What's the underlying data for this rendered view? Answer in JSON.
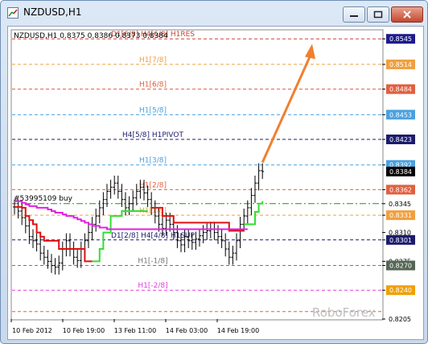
{
  "window": {
    "title": "NZDUSD,H1",
    "minimize_icon": "minimize-icon",
    "maximize_icon": "maximize-icon",
    "close_icon": "close-icon"
  },
  "chart_info": {
    "label": "NZDUSD,H1  0.8375 0.8386 0.8373 0.8384",
    "buy_label": "#53995109 buy",
    "watermark": "RoboForex"
  },
  "chart_data": {
    "type": "line",
    "title": "",
    "ylim": [
      0.8205,
      0.8555
    ],
    "y_ticks": [
      "0.8545",
      "0.8514",
      "0.8484",
      "0.8453",
      "0.8423",
      "0.8392",
      "0.8362",
      "0.8345",
      "0.8331",
      "0.8310",
      "0.8301",
      "0.8275",
      "0.8270",
      "0.8240",
      "0.8205"
    ],
    "x_ticks": [
      "10 Feb 2012",
      "10 Feb 19:00",
      "13 Feb 11:00",
      "14 Feb 03:00",
      "14 Feb 19:00"
    ],
    "current_price": "0.8384",
    "murrey_levels": [
      {
        "label": "D1[6/8] H4[6/8] H1RES",
        "value": 0.8545,
        "color": "#cc4433",
        "tag": "0.8545",
        "tag_color": "#1c1c8c"
      },
      {
        "label": "H1[7/8]",
        "value": 0.8514,
        "color": "#f0a040",
        "tag": "0.8514",
        "tag_color": "#f0a040"
      },
      {
        "label": "H1[6/8]",
        "value": 0.8484,
        "color": "#e06040",
        "tag": "0.8484",
        "tag_color": "#e06040"
      },
      {
        "label": "H1[5/8]",
        "value": 0.8453,
        "color": "#4aa0e0",
        "tag": "0.8453",
        "tag_color": "#4aa0e0"
      },
      {
        "label": "H4[5/8] H1PIVOT",
        "value": 0.8423,
        "color": "#1c1c6c",
        "tag": "0.8423",
        "tag_color": "#1c1c6c"
      },
      {
        "label": "H1[3/8]",
        "value": 0.8392,
        "color": "#4aa0e0",
        "tag": "0.8392",
        "tag_color": "#4aa0e0"
      },
      {
        "label": "H1[2/8]",
        "value": 0.8362,
        "color": "#e06040",
        "tag": "0.8362",
        "tag_color": "#e06040"
      },
      {
        "label": "H1[1/8]",
        "value": 0.8331,
        "color": "#f0a040",
        "tag": "0.8331",
        "tag_color": "#f0a040"
      },
      {
        "label": "D1[2/8] H4[4/8] H1SUP",
        "value": 0.8301,
        "color": "#1c1c6c",
        "tag": "0.8301",
        "tag_color": "#1c1c6c"
      },
      {
        "label": "H1[-1/8]",
        "value": 0.827,
        "color": "#777777",
        "tag": "0.8270",
        "tag_color": "#556655"
      },
      {
        "label": "H1[-2/8]",
        "value": 0.824,
        "color": "#e040e0",
        "tag": "0.8240",
        "tag_color": "#f0a000"
      },
      {
        "label": "",
        "value": 0.8214,
        "color": "#e06040",
        "tag": "",
        "tag_color": ""
      }
    ],
    "buy_level": 0.8345,
    "series": [
      {
        "role": "price",
        "color": "#000000",
        "values": [
          0.8341,
          0.8336,
          0.8328,
          0.8318,
          0.8305,
          0.83,
          0.8296,
          0.8285,
          0.828,
          0.8275,
          0.827,
          0.8268,
          0.8273,
          0.829,
          0.83,
          0.829,
          0.828,
          0.8276,
          0.829,
          0.83,
          0.831,
          0.832,
          0.833,
          0.834,
          0.835,
          0.836,
          0.8365,
          0.837,
          0.836,
          0.835,
          0.834,
          0.8345,
          0.8352,
          0.836,
          0.8365,
          0.8358,
          0.835,
          0.834,
          0.833,
          0.832,
          0.8315,
          0.8325,
          0.832,
          0.831,
          0.83,
          0.8295,
          0.8305,
          0.83,
          0.8298,
          0.8302,
          0.8306,
          0.831,
          0.8312,
          0.8314,
          0.831,
          0.8305,
          0.83,
          0.829,
          0.828,
          0.8285,
          0.83,
          0.832,
          0.833,
          0.834,
          0.8355,
          0.837,
          0.8385,
          0.8384
        ]
      },
      {
        "role": "trend-red",
        "color": "#e01010",
        "values": [
          0.8341,
          0.8341,
          0.834,
          0.833,
          0.8325,
          0.832,
          0.831,
          0.8305,
          0.83,
          0.83,
          0.83,
          0.83,
          0.829,
          0.829,
          0.829,
          0.829,
          0.829,
          0.829,
          0.829,
          0.8275,
          0.8275,
          0.8275,
          null,
          null,
          null,
          null,
          null,
          null,
          null,
          null,
          null,
          null,
          null,
          null,
          null,
          null,
          null,
          0.834,
          0.834,
          0.834,
          0.833,
          0.833,
          0.833,
          0.8322,
          0.8322,
          0.8322,
          0.8322,
          0.8322,
          0.8322,
          0.8322,
          0.8322,
          0.8322,
          0.8322,
          0.8322,
          0.8322,
          0.8322,
          0.8322,
          0.8322,
          0.8312,
          0.8312,
          0.8312,
          0.8312,
          0.8312,
          null,
          null,
          null,
          null,
          null
        ]
      },
      {
        "role": "trend-green",
        "color": "#30e030",
        "values": [
          null,
          null,
          null,
          null,
          null,
          null,
          null,
          null,
          null,
          null,
          null,
          null,
          null,
          null,
          null,
          null,
          null,
          null,
          null,
          null,
          null,
          0.8275,
          0.8275,
          0.829,
          0.831,
          0.831,
          0.833,
          0.833,
          0.833,
          0.8336,
          0.8336,
          0.8336,
          0.8336,
          0.8336,
          0.8336,
          0.8336,
          0.8336,
          null,
          null,
          null,
          null,
          null,
          null,
          null,
          null,
          null,
          null,
          null,
          null,
          null,
          null,
          null,
          null,
          null,
          null,
          null,
          null,
          null,
          null,
          null,
          null,
          null,
          0.832,
          0.832,
          0.832,
          0.8335,
          0.8345,
          0.8348
        ]
      },
      {
        "role": "trend-magenta",
        "color": "#e020e0",
        "values": [
          0.8348,
          0.8348,
          0.8346,
          0.8344,
          0.8342,
          0.8342,
          0.834,
          0.834,
          0.834,
          0.8338,
          0.8336,
          0.8334,
          0.8334,
          0.8332,
          0.833,
          0.833,
          0.8328,
          0.8326,
          0.8324,
          0.8322,
          0.832,
          0.8318,
          0.8318,
          0.8316,
          0.8316,
          0.8314,
          0.8314,
          0.8314,
          0.8314,
          0.8314,
          0.8314,
          0.8314,
          0.8314,
          0.8314,
          0.8314,
          0.8314,
          0.8314,
          0.8314,
          0.8314,
          0.8314,
          0.8314,
          0.8314,
          0.8314,
          0.8314,
          0.8314,
          0.8314,
          0.8314,
          0.8314,
          0.8314,
          0.8314,
          0.8314,
          0.8314,
          0.8314,
          0.8314,
          0.8314,
          0.8314,
          0.8314,
          0.8314,
          0.8314,
          0.8314,
          0.8314,
          0.8314,
          0.8314,
          0.8314,
          null,
          null,
          null,
          null
        ]
      }
    ],
    "forecast_arrow": {
      "color": "#f08030",
      "from_x_index": 67,
      "from": 0.8395,
      "to_x_index": 80,
      "to": 0.8537
    }
  }
}
